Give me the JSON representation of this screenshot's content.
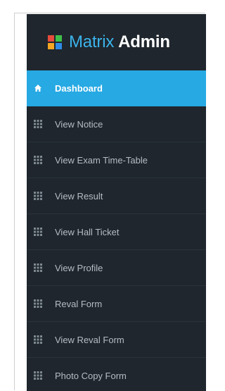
{
  "brand": {
    "part1": "Matrix",
    "part2": "Admin",
    "logo_colors": [
      "#e74c3c",
      "#3fbf4a",
      "#f5a623",
      "#2e8ae6"
    ]
  },
  "colors": {
    "sidebar_bg": "#1f262d",
    "active_bg": "#27a9e3",
    "text": "#b5bcc3",
    "accent": "#3bb3ea"
  },
  "sidebar": {
    "items": [
      {
        "label": "Dashboard",
        "icon": "home-icon",
        "active": true
      },
      {
        "label": "View Notice",
        "icon": "grid-icon",
        "active": false
      },
      {
        "label": "View Exam Time-Table",
        "icon": "grid-icon",
        "active": false
      },
      {
        "label": "View Result",
        "icon": "grid-icon",
        "active": false
      },
      {
        "label": "View Hall Ticket",
        "icon": "grid-icon",
        "active": false
      },
      {
        "label": "View Profile",
        "icon": "grid-icon",
        "active": false
      },
      {
        "label": "Reval Form",
        "icon": "grid-icon",
        "active": false
      },
      {
        "label": "View Reval Form",
        "icon": "grid-icon",
        "active": false
      },
      {
        "label": "Photo Copy Form",
        "icon": "grid-icon",
        "active": false
      }
    ]
  }
}
